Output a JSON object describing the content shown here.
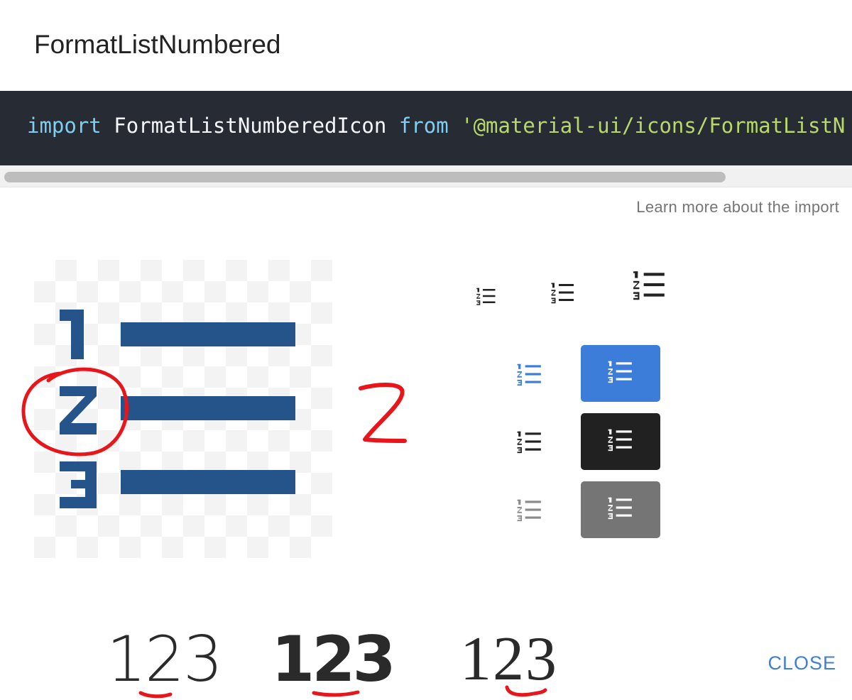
{
  "dialog": {
    "title": "FormatListNumbered",
    "code": {
      "keyword_import": "import",
      "identifier": "FormatListNumberedIcon",
      "keyword_from": "from",
      "module_path": "'@material-ui/icons/FormatListN"
    },
    "learn_more": "Learn more about the import",
    "close_label": "CLOSE"
  },
  "annotation": {
    "digit": "2",
    "color": "#e8161b"
  },
  "font_samples": [
    "123",
    "123",
    "123"
  ],
  "colors": {
    "icon_large": "#25548a",
    "primary": "#3b7dd8",
    "dark": "#212121",
    "grey": "#757575",
    "code_bg": "#272c34"
  },
  "icon_name": "format-list-numbered-icon"
}
